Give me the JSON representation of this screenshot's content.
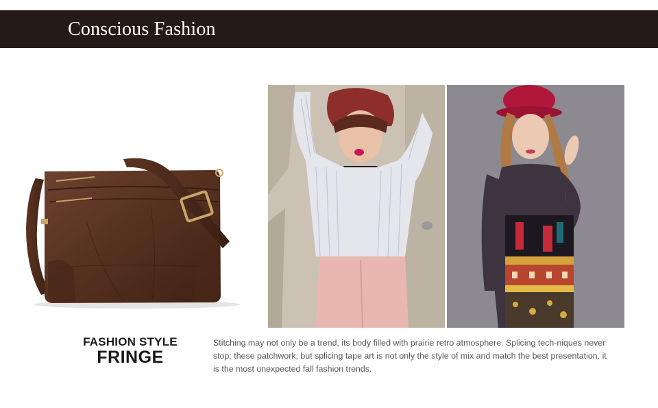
{
  "header": {
    "title": "Conscious Fashion",
    "background": "#241a17"
  },
  "product": {
    "image": "brown-leather-crossbody-bag",
    "color": "#5a3423"
  },
  "photos": [
    {
      "name": "model-striped-shirt-red-beret"
    },
    {
      "name": "model-red-hat-patterned-dress"
    }
  ],
  "style": {
    "line1": "FASHION STYLE",
    "line2": "FRINGE"
  },
  "description": "Stitching may not only be a trend, its body filled with prairie retro atmosphere. Splicing tech-niques never stop; these patchwork, but splicing tape art is not only the style of mix and match the best presentation, it is the most unexpected fall fashion trends."
}
